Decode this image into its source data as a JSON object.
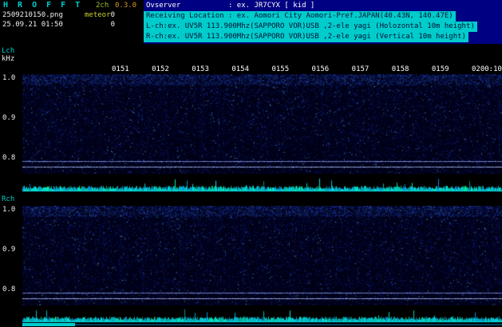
{
  "colors": {
    "background": "#000000",
    "panel_background": "#000082",
    "highlight": "#00cccc",
    "cyan": "#00cccc",
    "white": "#f0f0f0",
    "yellow": "#cfcf2a",
    "green": "#9ac32a",
    "orange": "#d69a2b",
    "noise_blue": "#2040c0",
    "carrier_line": "#96aaff",
    "trace": "#00e0e0"
  },
  "header": {
    "logo": "H R O F F T",
    "channel_mode": "2ch",
    "version": "0.3.0",
    "filename": "2509210150.png",
    "mode": "meteor",
    "counter_top": "0",
    "counter_bottom": "0",
    "datetime": "25.09.21 01:50",
    "info_lines": [
      {
        "text": "Ovserver           : ex. JR7CYX [ kid ]",
        "highlight": false
      },
      {
        "text": "Receiving Location : ex. Aomori City Aomori-Pref.JAPAN(40.43N, 140.47E)",
        "highlight": true
      },
      {
        "text": "L-ch:ex. UV5R 113.900Mhz(SAPPORO VOR)USB ,2-ele yagi (Holozontal 10m height)",
        "highlight": true
      },
      {
        "text": "R-ch:ex. UV5R 113.900Mhz(SAPPORO VOR)USB ,2-ele yagi (Vertical 10m height)",
        "highlight": true
      }
    ]
  },
  "time_axis": {
    "labels": [
      "0151",
      "0152",
      "0153",
      "0154",
      "0155",
      "0156",
      "0157",
      "0158",
      "0159",
      "0200:10"
    ]
  },
  "channels": [
    {
      "name": "Lch",
      "unit": "kHz",
      "freq_ticks": [
        "1.0",
        "0.9",
        "0.8"
      ]
    },
    {
      "name": "Rch",
      "unit": "",
      "freq_ticks": [
        "1.0",
        "0.9",
        "0.8"
      ]
    }
  ],
  "chart_data": [
    {
      "type": "heatmap",
      "title": "L-ch spectrogram 01:50-02:00",
      "ylabel": "kHz",
      "x_ticks": [
        "0151",
        "0152",
        "0153",
        "0154",
        "0155",
        "0156",
        "0157",
        "0158",
        "0159",
        "0200:10"
      ],
      "y_ticks": [
        "1.0",
        "0.9",
        "0.8"
      ],
      "ylim": [
        1.01,
        0.76
      ],
      "carrier_lines_khz": [
        0.792,
        0.778
      ],
      "description": "uniform dark-blue background radio noise, slightly denser near 1.0 kHz, no meteor echo traces; two continuous horizontal carrier lines just below 0.8 kHz"
    },
    {
      "type": "heatmap",
      "title": "R-ch spectrogram 01:50-02:00",
      "ylabel": "kHz",
      "x_ticks": [
        "0151",
        "0152",
        "0153",
        "0154",
        "0155",
        "0156",
        "0157",
        "0158",
        "0159",
        "0200:10"
      ],
      "y_ticks": [
        "1.0",
        "0.9",
        "0.8"
      ],
      "ylim": [
        1.01,
        0.76
      ],
      "carrier_lines_khz": [
        0.792,
        0.778
      ],
      "description": "same noise character as L-ch, no meteor echo traces; two continuous horizontal carrier lines just below 0.8 kHz"
    },
    {
      "type": "line",
      "title": "L-ch signal level",
      "description": "flat cyan noise baseline along bottom of channel with small random spikes, no meteor events (count 0)"
    },
    {
      "type": "line",
      "title": "R-ch signal level",
      "description": "flat cyan noise baseline along bottom of channel with small random spikes, no meteor events (count 0)"
    }
  ]
}
